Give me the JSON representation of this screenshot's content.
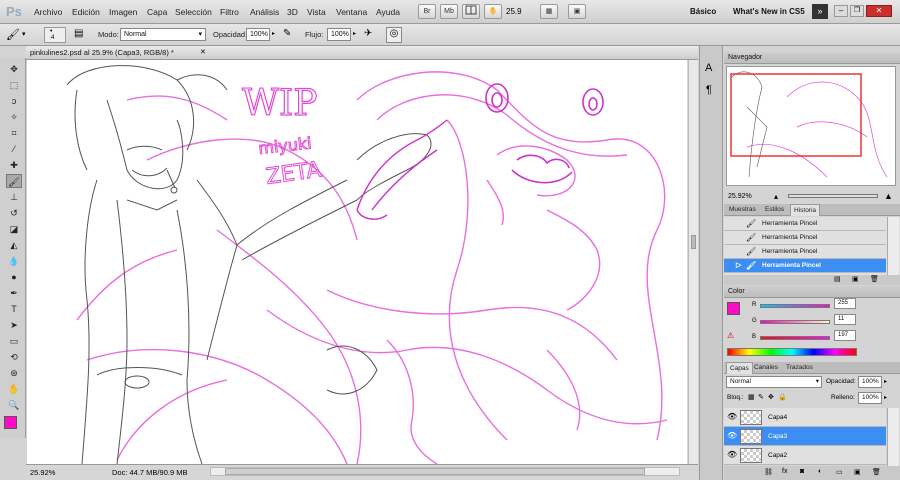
{
  "app": {
    "logo": "Ps",
    "menu": [
      "Archivo",
      "Edición",
      "Imagen",
      "Capa",
      "Selección",
      "Filtro",
      "Análisis",
      "3D",
      "Vista",
      "Ventana",
      "Ayuda"
    ],
    "menu_buttons": [
      "Br",
      "Mb"
    ],
    "zoom": "25.9",
    "workspace": "Básico",
    "whats_new": "What's New in CS5"
  },
  "options": {
    "brush_size": "4",
    "mode_label": "Modo:",
    "mode_value": "Normal",
    "opacity_label": "Opacidad:",
    "opacity_value": "100%",
    "flow_label": "Flujo:",
    "flow_value": "100%"
  },
  "document": {
    "tab_title": "pinkulines2.psd al 25.9% (Capa3, RGB/8) *",
    "status_zoom": "25.92%",
    "status_doc": "Doc: 44.7 MB/90.9 MB"
  },
  "canvas_text": {
    "wip": "WIP",
    "artist1": "miyuki",
    "artist2": "ZETA"
  },
  "navigator": {
    "title": "Navegador",
    "zoom": "25.92%"
  },
  "history": {
    "tabs": [
      "Muestras",
      "Estilos",
      "Historia"
    ],
    "items": [
      "Herramienta Pincel",
      "Herramienta Pincel",
      "Herramienta Pincel",
      "Herramienta Pincel"
    ],
    "selected_index": 3
  },
  "color": {
    "title": "Color",
    "r_label": "R",
    "g_label": "G",
    "b_label": "B",
    "r": "255",
    "g": "11",
    "b": "197",
    "fg_hex": "#ff0bc5"
  },
  "layers": {
    "tabs": [
      "Capas",
      "Canales",
      "Trazados"
    ],
    "mode": "Normal",
    "opacity_label": "Opacidad:",
    "opacity_value": "100%",
    "lock_label": "Bloq.:",
    "fill_label": "Relleno:",
    "fill_value": "100%",
    "items": [
      {
        "name": "Capa4"
      },
      {
        "name": "Capa3"
      },
      {
        "name": "Capa2"
      }
    ],
    "selected_index": 1
  },
  "colors": {
    "accent": "#3c8ef2",
    "sketch": "#e040d0",
    "foreground": "#ff0bc5"
  }
}
